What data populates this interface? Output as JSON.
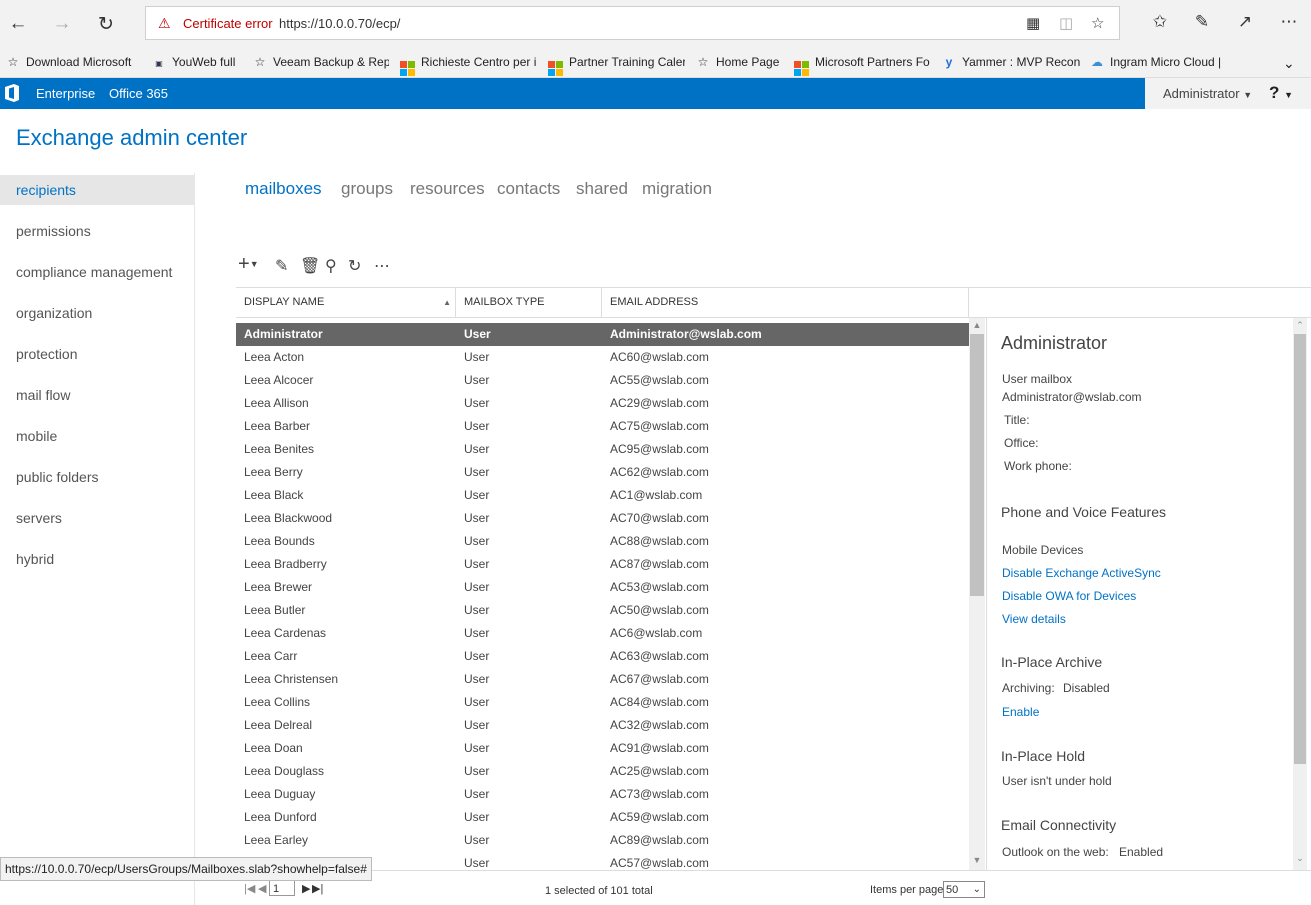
{
  "browser": {
    "cert_error": "Certificate error",
    "url": "https://10.0.0.70/ecp/",
    "status_url": "https://10.0.0.70/ecp/UsersGroups/Mailboxes.slab?showhelp=false#"
  },
  "favorites": [
    {
      "label": "Download Microsoft",
      "icon": "star-icon"
    },
    {
      "label": "YouWeb full",
      "icon": "bank-logo-icon"
    },
    {
      "label": "Veeam Backup & Rep",
      "icon": "star-icon"
    },
    {
      "label": "Richieste Centro per i",
      "icon": "microsoft-logo-icon"
    },
    {
      "label": "Partner Training Caler",
      "icon": "microsoft-logo-icon"
    },
    {
      "label": "Home Page",
      "icon": "star-icon"
    },
    {
      "label": "Microsoft Partners Fo",
      "icon": "microsoft-logo-icon"
    },
    {
      "label": "Yammer : MVP Recon",
      "icon": "yammer-icon"
    },
    {
      "label": "Ingram Micro Cloud |",
      "icon": "cloud-icon"
    }
  ],
  "o365": {
    "enterprise": "Enterprise",
    "office365": "Office 365",
    "user": "Administrator",
    "help": "?"
  },
  "app_title": "Exchange admin center",
  "left_nav": [
    "recipients",
    "permissions",
    "compliance management",
    "organization",
    "protection",
    "mail flow",
    "mobile",
    "public folders",
    "servers",
    "hybrid"
  ],
  "tabs": [
    "mailboxes",
    "groups",
    "resources",
    "contacts",
    "shared",
    "migration"
  ],
  "columns": [
    "DISPLAY NAME",
    "MAILBOX TYPE",
    "EMAIL ADDRESS"
  ],
  "rows": [
    [
      "Administrator",
      "User",
      "Administrator@wslab.com"
    ],
    [
      "Leea Acton",
      "User",
      "AC60@wslab.com"
    ],
    [
      "Leea Alcocer",
      "User",
      "AC55@wslab.com"
    ],
    [
      "Leea Allison",
      "User",
      "AC29@wslab.com"
    ],
    [
      "Leea Barber",
      "User",
      "AC75@wslab.com"
    ],
    [
      "Leea Benites",
      "User",
      "AC95@wslab.com"
    ],
    [
      "Leea Berry",
      "User",
      "AC62@wslab.com"
    ],
    [
      "Leea Black",
      "User",
      "AC1@wslab.com"
    ],
    [
      "Leea Blackwood",
      "User",
      "AC70@wslab.com"
    ],
    [
      "Leea Bounds",
      "User",
      "AC88@wslab.com"
    ],
    [
      "Leea Bradberry",
      "User",
      "AC87@wslab.com"
    ],
    [
      "Leea Brewer",
      "User",
      "AC53@wslab.com"
    ],
    [
      "Leea Butler",
      "User",
      "AC50@wslab.com"
    ],
    [
      "Leea Cardenas",
      "User",
      "AC6@wslab.com"
    ],
    [
      "Leea Carr",
      "User",
      "AC63@wslab.com"
    ],
    [
      "Leea Christensen",
      "User",
      "AC67@wslab.com"
    ],
    [
      "Leea Collins",
      "User",
      "AC84@wslab.com"
    ],
    [
      "Leea Delreal",
      "User",
      "AC32@wslab.com"
    ],
    [
      "Leea Doan",
      "User",
      "AC91@wslab.com"
    ],
    [
      "Leea Douglass",
      "User",
      "AC25@wslab.com"
    ],
    [
      "Leea Duguay",
      "User",
      "AC73@wslab.com"
    ],
    [
      "Leea Dunford",
      "User",
      "AC59@wslab.com"
    ],
    [
      "Leea Earley",
      "User",
      "AC89@wslab.com"
    ],
    [
      "",
      "User",
      "AC57@wslab.com"
    ]
  ],
  "details": {
    "name": "Administrator",
    "mailbox_type": "User mailbox",
    "email": "Administrator@wslab.com",
    "title_label": "Title:",
    "office_label": "Office:",
    "phone_label": "Work phone:",
    "phone_voice_heading": "Phone and Voice Features",
    "mobile_devices": "Mobile Devices",
    "disable_activesync": "Disable Exchange ActiveSync",
    "disable_owa": "Disable OWA for Devices",
    "view_details": "View details",
    "archive_heading": "In-Place Archive",
    "archiving_label": "Archiving:",
    "archiving_value": "Disabled",
    "enable": "Enable",
    "hold_heading": "In-Place Hold",
    "hold_status": "User isn't under hold",
    "email_conn_heading": "Email Connectivity",
    "owa_label": "Outlook on the web:",
    "owa_value": "Enabled"
  },
  "footer": {
    "page": "1",
    "selection_status": "1 selected of 101 total",
    "items_per_page_label": "Items per page",
    "items_per_page": "50"
  },
  "colors": {
    "accent": "#0072c6",
    "selected_row": "#666666"
  }
}
